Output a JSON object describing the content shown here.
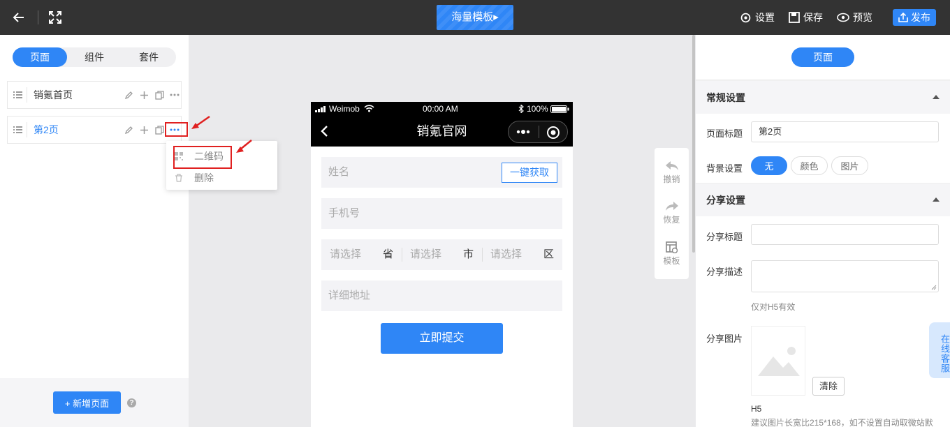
{
  "topbar": {
    "title": "海量模板",
    "actions": {
      "settings": "设置",
      "save": "保存",
      "preview": "预览",
      "publish": "发布"
    }
  },
  "left_panel": {
    "tabs": [
      "页面",
      "组件",
      "套件"
    ],
    "pages": [
      {
        "name": "销氪首页"
      },
      {
        "name": "第2页"
      }
    ],
    "context_menu": [
      "二维码",
      "删除"
    ],
    "add_page": "+ 新增页面",
    "help": "?"
  },
  "phone": {
    "status": {
      "carrier": "Weimob",
      "time": "00:00 AM",
      "battery": "100%"
    },
    "title": "销氪官网",
    "form": {
      "name_placeholder": "姓名",
      "fetch_button": "一键获取",
      "phone_placeholder": "手机号",
      "region": {
        "placeholder": "请选择",
        "province": "省",
        "city": "市",
        "district": "区"
      },
      "address_placeholder": "详细地址",
      "submit": "立即提交"
    }
  },
  "toolbox": {
    "undo": "撤销",
    "redo": "恢复",
    "template": "模板"
  },
  "right_panel": {
    "header_button": "页面",
    "general": {
      "title": "常规设置",
      "page_title_label": "页面标题",
      "page_title_value": "第2页",
      "bg_label": "背景设置",
      "bg_options": [
        "无",
        "颜色",
        "图片"
      ],
      "bg_selected": "无"
    },
    "share": {
      "title": "分享设置",
      "title_label": "分享标题",
      "desc_label": "分享描述",
      "desc_hint": "仅对H5有效",
      "image_label": "分享图片",
      "clear_button": "清除",
      "h5_label": "H5",
      "image_hint": "建议图片长宽比215*168，如不设置自动取微站默"
    },
    "customer_service": "在线客服"
  },
  "colors": {
    "accent": "#2f86f6",
    "topbar": "#333333",
    "highlight": "#e02020"
  }
}
